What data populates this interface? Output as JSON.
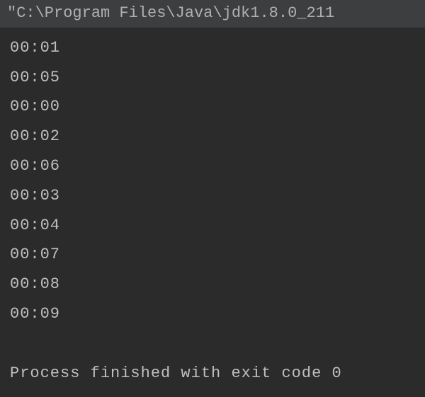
{
  "console": {
    "command": "\"C:\\Program Files\\Java\\jdk1.8.0_211",
    "output_lines": [
      "00:01",
      "00:05",
      "00:00",
      "00:02",
      "00:06",
      "00:03",
      "00:04",
      "00:07",
      "00:08",
      "00:09"
    ],
    "exit_message": "Process finished with exit code 0"
  }
}
